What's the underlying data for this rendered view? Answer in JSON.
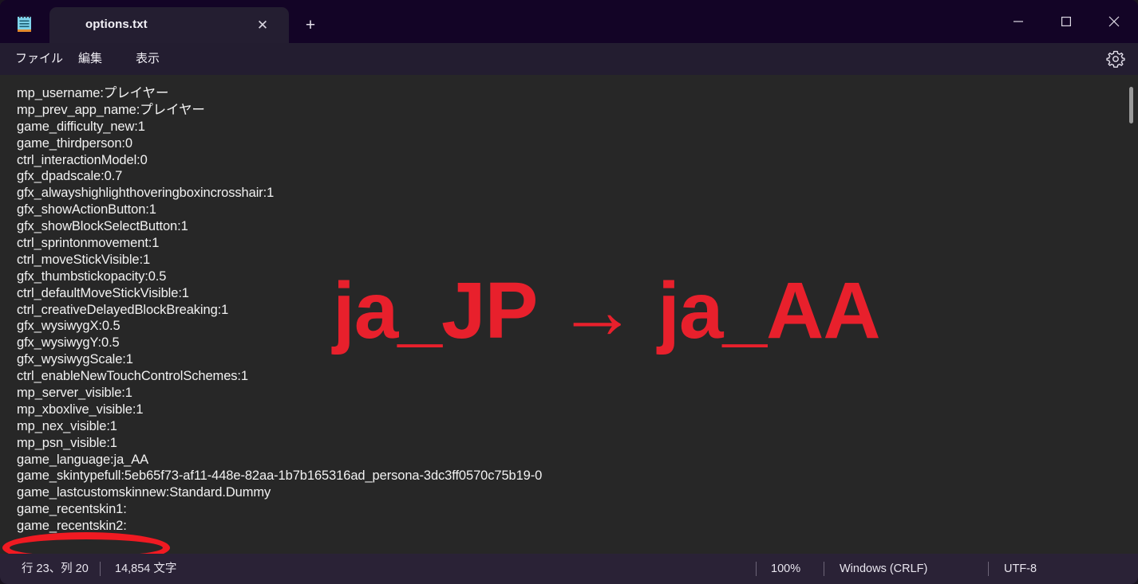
{
  "window": {
    "app_icon": "notepad-icon",
    "controls": {
      "minimize": "minimize-icon",
      "maximize": "maximize-icon",
      "close": "close-icon"
    }
  },
  "tabs": {
    "active_title": "options.txt",
    "close_glyph": "✕",
    "new_tab_glyph": "+"
  },
  "menu": {
    "file": "ファイル",
    "edit": "編集",
    "view": "表示",
    "settings_icon": "gear-icon"
  },
  "editor": {
    "lines": [
      "mp_username:プレイヤー",
      "mp_prev_app_name:プレイヤー",
      "game_difficulty_new:1",
      "game_thirdperson:0",
      "ctrl_interactionModel:0",
      "gfx_dpadscale:0.7",
      "gfx_alwayshighlighthoveringboxincrosshair:1",
      "gfx_showActionButton:1",
      "gfx_showBlockSelectButton:1",
      "ctrl_sprintonmovement:1",
      "ctrl_moveStickVisible:1",
      "gfx_thumbstickopacity:0.5",
      "ctrl_defaultMoveStickVisible:1",
      "ctrl_creativeDelayedBlockBreaking:1",
      "gfx_wysiwygX:0.5",
      "gfx_wysiwygY:0.5",
      "gfx_wysiwygScale:1",
      "ctrl_enableNewTouchControlSchemes:1",
      "mp_server_visible:1",
      "mp_xboxlive_visible:1",
      "mp_nex_visible:1",
      "mp_psn_visible:1",
      "game_language:ja_AA",
      "game_skintypefull:5eb65f73-af11-448e-82aa-1b7b165316ad_persona-3dc3ff0570c75b19-0",
      "game_lastcustomskinnew:Standard.Dummy",
      "game_recentskin1:",
      "game_recentskin2:"
    ]
  },
  "annotations": {
    "callout_text": "ja_JP → ja_AA",
    "callout_color": "#E8202C",
    "highlight_color": "#F01A22",
    "highlighted_line": "game_language:ja_AA"
  },
  "statusbar": {
    "position": "行 23、列 20",
    "char_count": "14,854 文字",
    "zoom": "100%",
    "line_ending": "Windows (CRLF)",
    "encoding": "UTF-8"
  }
}
